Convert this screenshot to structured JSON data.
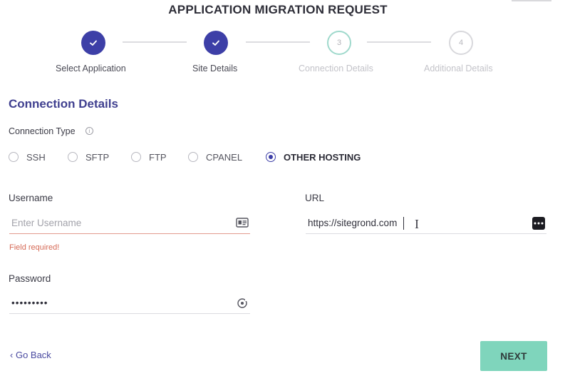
{
  "page": {
    "title": "APPLICATION MIGRATION REQUEST"
  },
  "stepper": {
    "steps": [
      {
        "number": "1",
        "label": "Select Application",
        "state": "completed"
      },
      {
        "number": "2",
        "label": "Site Details",
        "state": "completed"
      },
      {
        "number": "3",
        "label": "Connection Details",
        "state": "current"
      },
      {
        "number": "4",
        "label": "Additional Details",
        "state": "upcoming"
      }
    ],
    "check_icon": "check-icon"
  },
  "section": {
    "title": "Connection Details"
  },
  "connection_type": {
    "label": "Connection Type",
    "info_icon": "info-icon",
    "options": [
      "SSH",
      "SFTP",
      "FTP",
      "CPANEL",
      "OTHER HOSTING"
    ],
    "selected": "OTHER HOSTING"
  },
  "form": {
    "username": {
      "label": "Username",
      "placeholder": "Enter Username",
      "value": "",
      "error": "Field required!",
      "icon": "id-card-icon"
    },
    "password": {
      "label": "Password",
      "value": "•••••••••",
      "icon": "reveal-password-icon"
    },
    "url": {
      "label": "URL",
      "value": "https://sitegrond.com",
      "icon": "more-icon"
    }
  },
  "actions": {
    "back_label": "Go Back",
    "next_label": "NEXT"
  },
  "colors": {
    "accent": "#3d3fa7",
    "current_step": "#9fd9cc",
    "error": "#d66a56",
    "next_button": "#7fd5bc"
  }
}
